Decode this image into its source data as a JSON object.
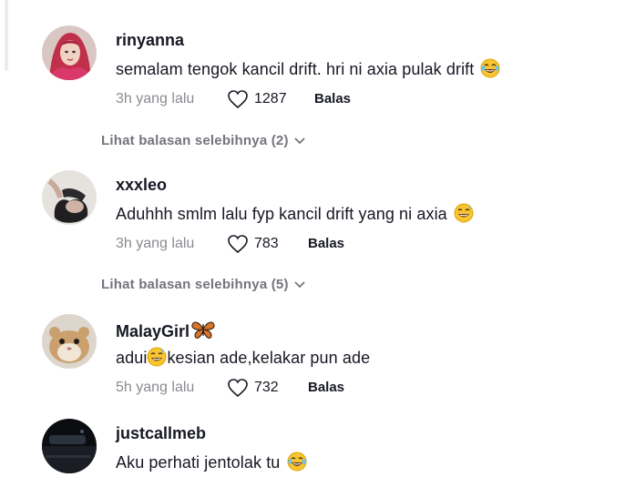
{
  "comments": [
    {
      "username": "rinyanna",
      "text": "semalam tengok kancil drift. hri ni axia pulak drift",
      "emoji": "laughing-tears-emoji",
      "time": "3h yang lalu",
      "likes": "1287",
      "reply_label": "Balas",
      "more_replies": "Lihat balasan selebihnya (2)"
    },
    {
      "username": "xxxleo",
      "text": "Aduhhh smlm lalu fyp kancil drift yang ni axia",
      "emoji": "sweat-smile-emoji",
      "time": "3h yang lalu",
      "likes": "783",
      "reply_label": "Balas",
      "more_replies": "Lihat balasan selebihnya (5)"
    },
    {
      "username": "MalayGirl",
      "username_badge": "butterfly-emoji",
      "text_before": "adui",
      "text_after": "kesian ade,kelakar pun ade",
      "emoji": "sweat-smile-emoji",
      "time": "5h yang lalu",
      "likes": "732",
      "reply_label": "Balas"
    },
    {
      "username": "justcallmeb",
      "text": "Aku perhati jentolak tu",
      "emoji": "laughing-tears-emoji"
    }
  ]
}
